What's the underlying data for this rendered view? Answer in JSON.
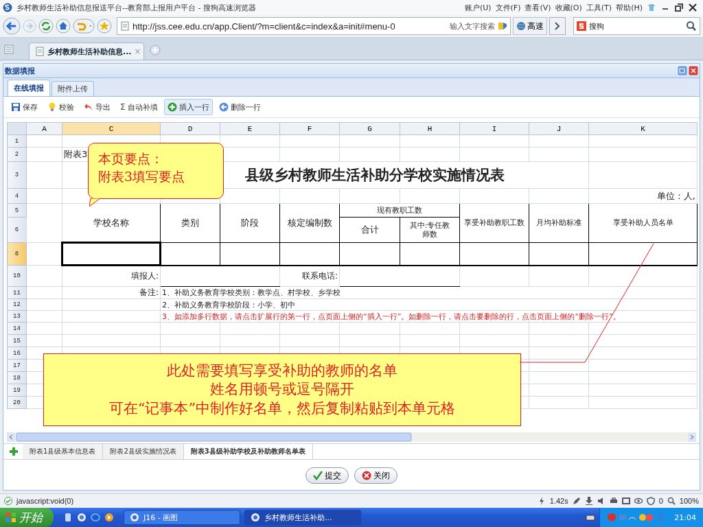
{
  "browser": {
    "title": "乡村教师生活补助信息报送平台--教育部上报用户平台 - 搜狗高速浏览器",
    "menus": [
      "账户(U)",
      "文件(F)",
      "查看(V)",
      "收藏(O)",
      "工具(T)",
      "帮助(H)"
    ],
    "url": "http://jss.cee.edu.cn/app.Client/?m=client&c=index&a=init#menu-0",
    "search_hint": "输入文字搜索",
    "speed_button": "高速",
    "search_engine": "搜狗",
    "tab": {
      "title": "乡村教师生活补助信息...",
      "close": "×"
    }
  },
  "panel": {
    "title": "数据填报",
    "tabs": [
      {
        "label": "在线填报",
        "selected": true
      },
      {
        "label": "附件上传",
        "selected": false
      }
    ],
    "toolbar": [
      {
        "kind": "save",
        "label": "保存",
        "highlighted": false
      },
      {
        "kind": "check",
        "label": "校验",
        "highlighted": false
      },
      {
        "kind": "export",
        "label": "导出",
        "highlighted": false
      },
      {
        "kind": "sum",
        "glyph": "Σ",
        "label": "自动补填",
        "highlighted": false
      },
      {
        "kind": "insert",
        "label": "插入一行",
        "highlighted": true
      },
      {
        "kind": "delete",
        "label": "删除一行",
        "highlighted": false
      }
    ]
  },
  "sheet": {
    "columns": [
      {
        "label": "A",
        "selected": false
      },
      {
        "label": "C",
        "selected": true
      },
      {
        "label": "D",
        "selected": false
      },
      {
        "label": "E",
        "selected": false
      },
      {
        "label": "F",
        "selected": false
      },
      {
        "label": "G",
        "selected": false
      },
      {
        "label": "H",
        "selected": false
      },
      {
        "label": "I",
        "selected": false
      },
      {
        "label": "J",
        "selected": false
      },
      {
        "label": "K",
        "selected": false
      }
    ],
    "rows": [
      {
        "label": "1",
        "selected": false,
        "kind": "blank"
      },
      {
        "label": "2",
        "selected": false,
        "kind": "caption",
        "caption": "附表3"
      },
      {
        "label": "3",
        "selected": false,
        "kind": "title",
        "title": "县级乡村教师生活补助分学校实施情况表"
      },
      {
        "label": "4",
        "selected": false,
        "kind": "unit",
        "unit": "单位：人,"
      },
      {
        "label": "5",
        "selected": false,
        "kind": "header_top",
        "school": "学校名称",
        "type": "类别",
        "stage": "阶段",
        "quota": "核定编制数",
        "staff": "现有教职工数",
        "subsidized": "享受补助教职工数",
        "standard": "月均补助标准",
        "names": "享受补助人员名单"
      },
      {
        "label": "6",
        "selected": false,
        "kind": "header_bottom",
        "total": "合计",
        "fulltime": "其中:专任教师数"
      },
      {
        "label": "8",
        "selected": true,
        "kind": "entry"
      },
      {
        "label": "10",
        "selected": false,
        "kind": "contact",
        "reporter_label": "填报人:",
        "phone_label": "联系电话:"
      },
      {
        "label": "11",
        "selected": false,
        "kind": "note",
        "note_label": "备注:",
        "note": {
          "kind": "normal",
          "text": "1、补助义务教育学校类别：教学点、村学校、乡学校"
        }
      },
      {
        "label": "12",
        "selected": false,
        "kind": "note",
        "note": {
          "kind": "normal",
          "text": "2、补助义务教育学校阶段：小学、初中"
        }
      },
      {
        "label": "13",
        "selected": false,
        "kind": "note",
        "note": {
          "kind": "warning",
          "text": "3、如添加多行数据，请点击扩展行的第一行，点页面上侧的“插入一行”。如删除一行，请点击要删除的行，点击页面上侧的“删除一行”。"
        }
      },
      {
        "label": "14",
        "selected": false,
        "kind": "blank"
      },
      {
        "label": "15",
        "selected": false,
        "kind": "blank"
      },
      {
        "label": "16",
        "selected": false,
        "kind": "blank"
      },
      {
        "label": "17",
        "selected": false,
        "kind": "blank"
      },
      {
        "label": "18",
        "selected": false,
        "kind": "blank"
      },
      {
        "label": "19",
        "selected": false,
        "kind": "blank"
      },
      {
        "label": "20",
        "selected": false,
        "kind": "blank"
      }
    ],
    "callouts": [
      {
        "kind": "top",
        "lines": [
          "本页要点：",
          "附表3填写要点"
        ]
      },
      {
        "kind": "bottom",
        "lines": [
          "此处需要填写享受补助的教师的名单",
          "姓名用顿号或逗号隔开",
          "可在“记事本”中制作好名单，然后复制粘贴到本单元格"
        ]
      }
    ],
    "sheet_tabs": [
      {
        "label": "附表1县级基本信息表",
        "selected": false
      },
      {
        "label": "附表2县级实施情况表",
        "selected": false
      },
      {
        "label": "附表3县级补助学校及补助教师名单表",
        "selected": true
      }
    ]
  },
  "buttons": [
    {
      "kind": "submit",
      "label": "提交"
    },
    {
      "kind": "close",
      "label": "关闭"
    }
  ],
  "status_bar": {
    "text": "javascript:void(0)",
    "load_time": "1.42s",
    "blocked": "0",
    "zoom": "100%"
  },
  "taskbar": {
    "start": "开始",
    "tasks": [
      {
        "label": "J16 - 画图",
        "selected": false
      },
      {
        "label": "乡村教师生活补助...",
        "selected": true
      }
    ],
    "clock": "21:04"
  }
}
